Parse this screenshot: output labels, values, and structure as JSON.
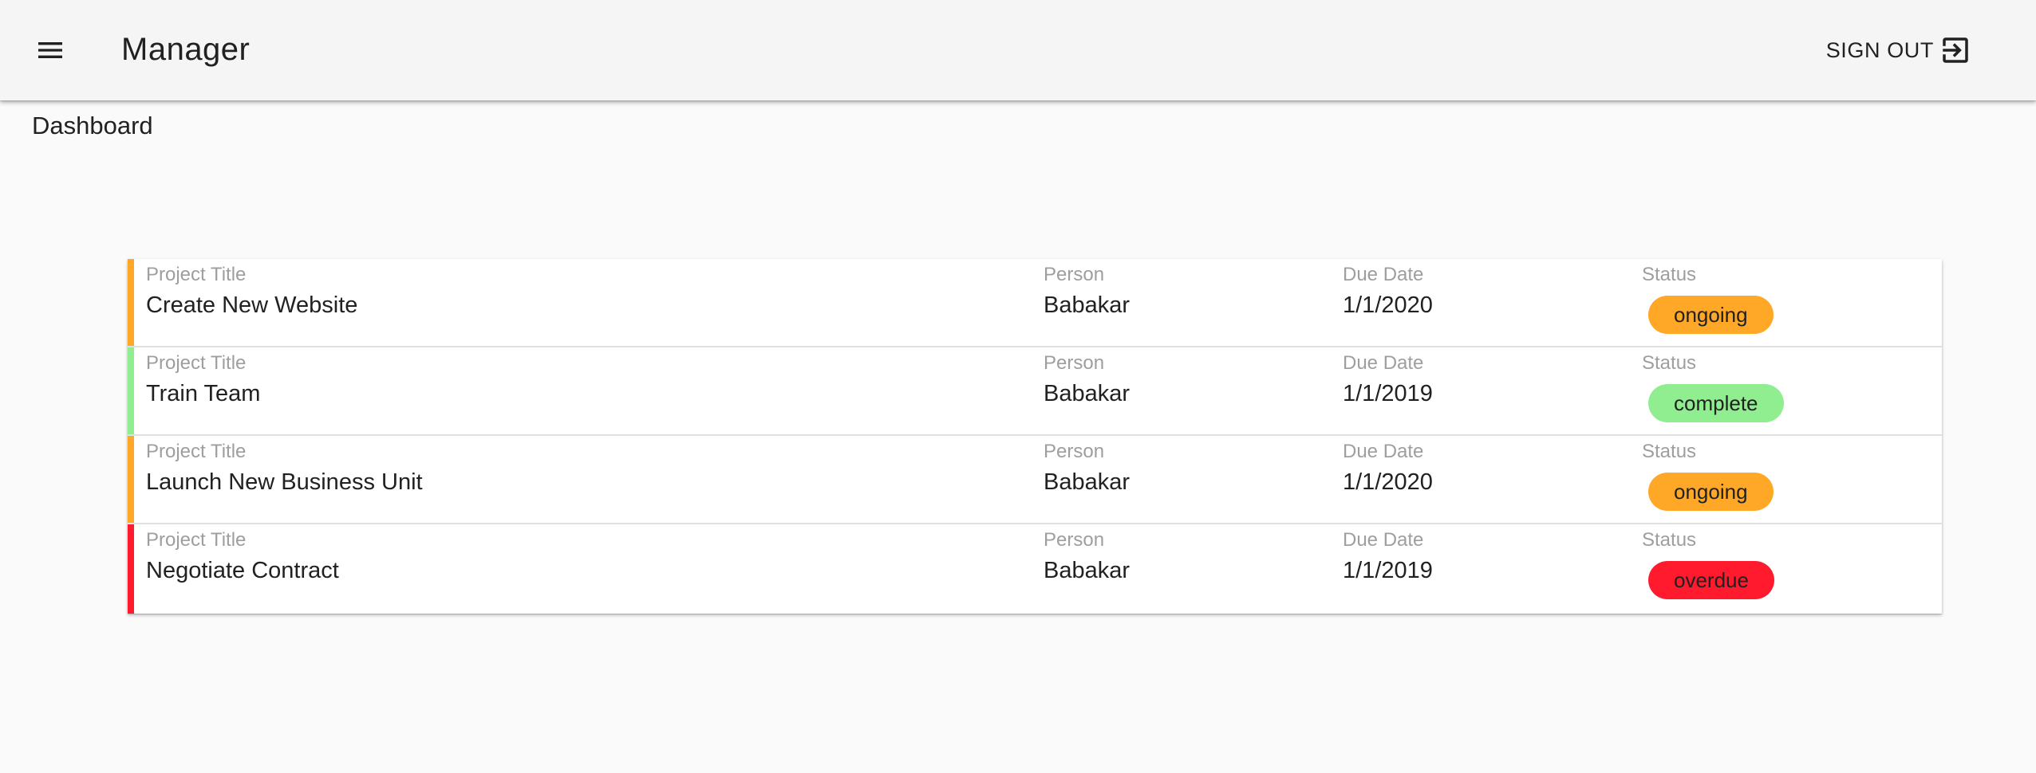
{
  "app": {
    "title": "Manager",
    "menu_icon": "hamburger-menu-icon",
    "sign_out_label": "SIGN OUT",
    "sign_out_icon": "exit-to-app-icon"
  },
  "page": {
    "heading": "Dashboard"
  },
  "columns": {
    "title": "Project Title",
    "person": "Person",
    "due_date": "Due Date",
    "status": "Status"
  },
  "status_colors": {
    "ongoing": "#ffa726",
    "complete": "#90ee90",
    "overdue": "#ff1a2e"
  },
  "projects": [
    {
      "title": "Create New Website",
      "person": "Babakar",
      "due_date": "1/1/2020",
      "status": "ongoing",
      "color": "#ffa726"
    },
    {
      "title": "Train Team",
      "person": "Babakar",
      "due_date": "1/1/2019",
      "status": "complete",
      "color": "#90ee90"
    },
    {
      "title": "Launch New Business Unit",
      "person": "Babakar",
      "due_date": "1/1/2020",
      "status": "ongoing",
      "color": "#ffa726"
    },
    {
      "title": "Negotiate Contract",
      "person": "Babakar",
      "due_date": "1/1/2019",
      "status": "overdue",
      "color": "#ff1a2e"
    }
  ]
}
